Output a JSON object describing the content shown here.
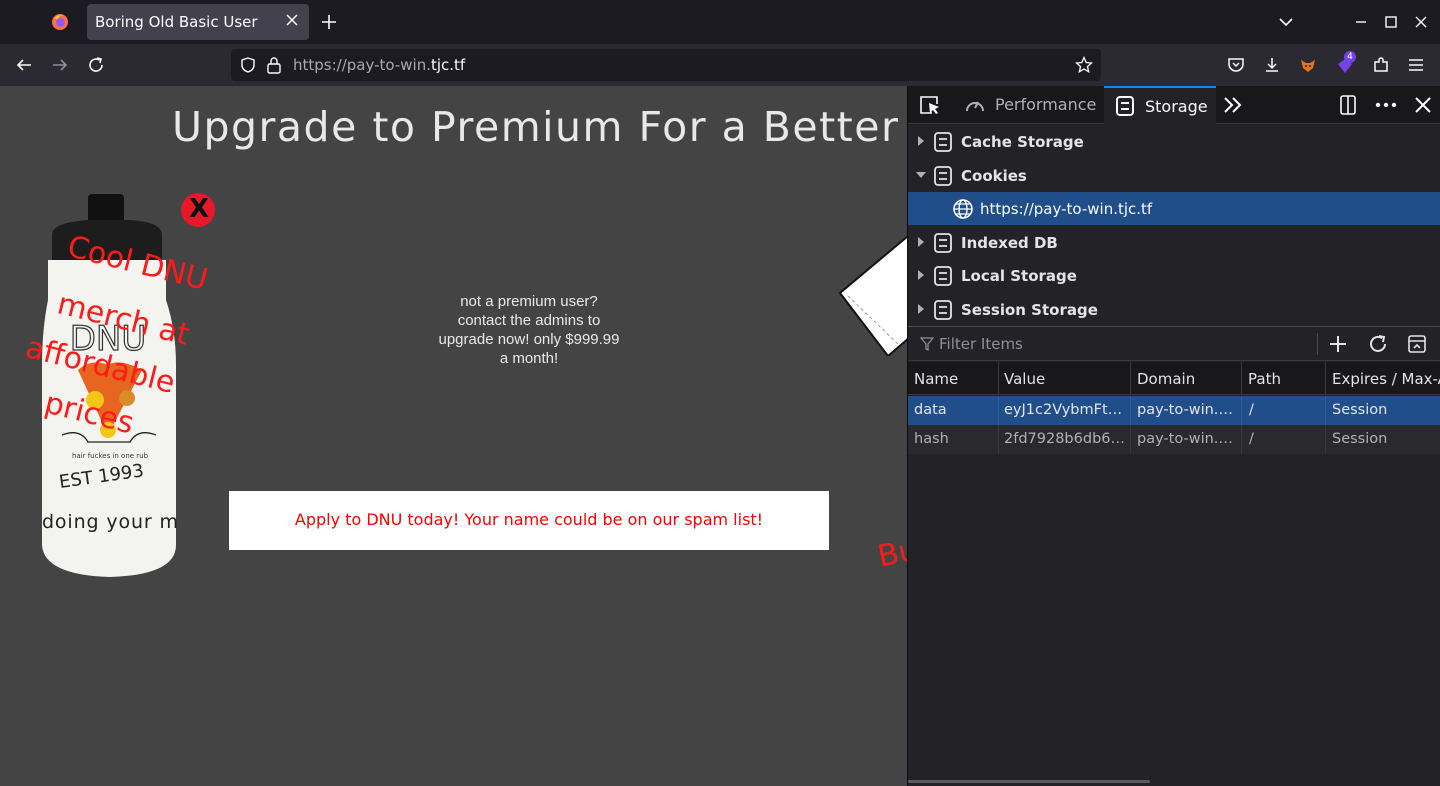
{
  "browser": {
    "tab_title": "Boring Old Basic User",
    "url_prefix": "https://pay-to-win.",
    "url_domain": "tjc.tf",
    "extension_badge": "4"
  },
  "page": {
    "headline": "Upgrade to Premium For a Better E",
    "bottle_caption_lines": [
      "Cool DNU",
      "merch at",
      "affordable",
      "prices"
    ],
    "bottle_print": {
      "brand": "DNU",
      "slogan": "hair fuckes in one rub",
      "est": "EST 1993",
      "tagline": "doing your m"
    },
    "close_symbol": "X",
    "premium_message": "not a premium user?\ncontact the admins to\nupgrade now! only $999.99\na month!",
    "spam_banner": "Apply to DNU today! Your name could be on our spam list!",
    "partial_text": "Bu"
  },
  "devtools": {
    "tabs": [
      {
        "label": "Performance",
        "active": false
      },
      {
        "label": "Storage",
        "active": true
      }
    ],
    "tree": [
      {
        "label": "Cache Storage",
        "expanded": false
      },
      {
        "label": "Cookies",
        "expanded": true
      },
      {
        "label": "https://pay-to-win.tjc.tf",
        "selected": true
      },
      {
        "label": "Indexed DB",
        "expanded": false
      },
      {
        "label": "Local Storage",
        "expanded": false
      },
      {
        "label": "Session Storage",
        "expanded": false
      }
    ],
    "filter_placeholder": "Filter Items",
    "columns": [
      "Name",
      "Value",
      "Domain",
      "Path",
      "Expires / Max-A"
    ],
    "rows": [
      {
        "name": "data",
        "value": "eyJ1c2VybmFtZ…",
        "domain": "pay-to-win.t…",
        "path": "/",
        "expires": "Session"
      },
      {
        "name": "hash",
        "value": "2fd7928b6db6…",
        "domain": "pay-to-win.t…",
        "path": "/",
        "expires": "Session"
      }
    ]
  }
}
